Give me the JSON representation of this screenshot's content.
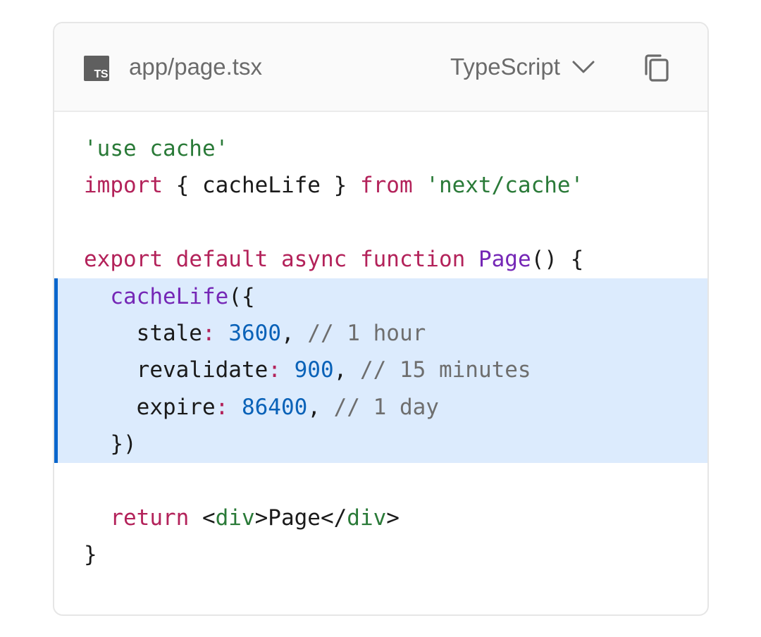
{
  "file": {
    "icon_label": "TS",
    "name": "app/page.tsx"
  },
  "language": {
    "selected": "TypeScript"
  },
  "code": {
    "lines": [
      [
        {
          "t": "'use cache'",
          "c": "str"
        }
      ],
      [
        {
          "t": "import",
          "c": "kw"
        },
        {
          "t": " { cacheLife } ",
          "c": "pl"
        },
        {
          "t": "from",
          "c": "kw"
        },
        {
          "t": " ",
          "c": "pl"
        },
        {
          "t": "'next/cache'",
          "c": "str"
        }
      ],
      [],
      [
        {
          "t": "export",
          "c": "kw"
        },
        {
          "t": " ",
          "c": "pl"
        },
        {
          "t": "default",
          "c": "kw"
        },
        {
          "t": " ",
          "c": "pl"
        },
        {
          "t": "async",
          "c": "kw"
        },
        {
          "t": " ",
          "c": "pl"
        },
        {
          "t": "function",
          "c": "kw"
        },
        {
          "t": " ",
          "c": "pl"
        },
        {
          "t": "Page",
          "c": "fn"
        },
        {
          "t": "() {",
          "c": "pl"
        }
      ],
      [
        {
          "t": "  ",
          "c": "pl"
        },
        {
          "t": "cacheLife",
          "c": "fn"
        },
        {
          "t": "({",
          "c": "pl"
        }
      ],
      [
        {
          "t": "    stale",
          "c": "pl"
        },
        {
          "t": ":",
          "c": "op"
        },
        {
          "t": " ",
          "c": "pl"
        },
        {
          "t": "3600",
          "c": "num"
        },
        {
          "t": ", ",
          "c": "pl"
        },
        {
          "t": "// 1 hour",
          "c": "cm"
        }
      ],
      [
        {
          "t": "    revalidate",
          "c": "pl"
        },
        {
          "t": ":",
          "c": "op"
        },
        {
          "t": " ",
          "c": "pl"
        },
        {
          "t": "900",
          "c": "num"
        },
        {
          "t": ", ",
          "c": "pl"
        },
        {
          "t": "// 15 minutes",
          "c": "cm"
        }
      ],
      [
        {
          "t": "    expire",
          "c": "pl"
        },
        {
          "t": ":",
          "c": "op"
        },
        {
          "t": " ",
          "c": "pl"
        },
        {
          "t": "86400",
          "c": "num"
        },
        {
          "t": ", ",
          "c": "pl"
        },
        {
          "t": "// 1 day",
          "c": "cm"
        }
      ],
      [
        {
          "t": "  })",
          "c": "pl"
        }
      ],
      [],
      [
        {
          "t": "  ",
          "c": "pl"
        },
        {
          "t": "return",
          "c": "kw"
        },
        {
          "t": " <",
          "c": "pl"
        },
        {
          "t": "div",
          "c": "str"
        },
        {
          "t": ">Page</",
          "c": "pl"
        },
        {
          "t": "div",
          "c": "str"
        },
        {
          "t": ">",
          "c": "pl"
        }
      ],
      [
        {
          "t": "}",
          "c": "pl"
        }
      ]
    ],
    "highlighted_lines": [
      5,
      6,
      7,
      8,
      9
    ]
  },
  "icons": {
    "file_type": "typescript-file-icon",
    "dropdown": "chevron-down-icon",
    "copy": "copy-icon"
  },
  "colors": {
    "keyword": "#b3225a",
    "string": "#2a7a38",
    "function": "#7527b6",
    "number": "#0a62b8",
    "comment": "#6e6e6e",
    "highlight_bg": "#dcebfd",
    "highlight_bar": "#0a66cc"
  }
}
